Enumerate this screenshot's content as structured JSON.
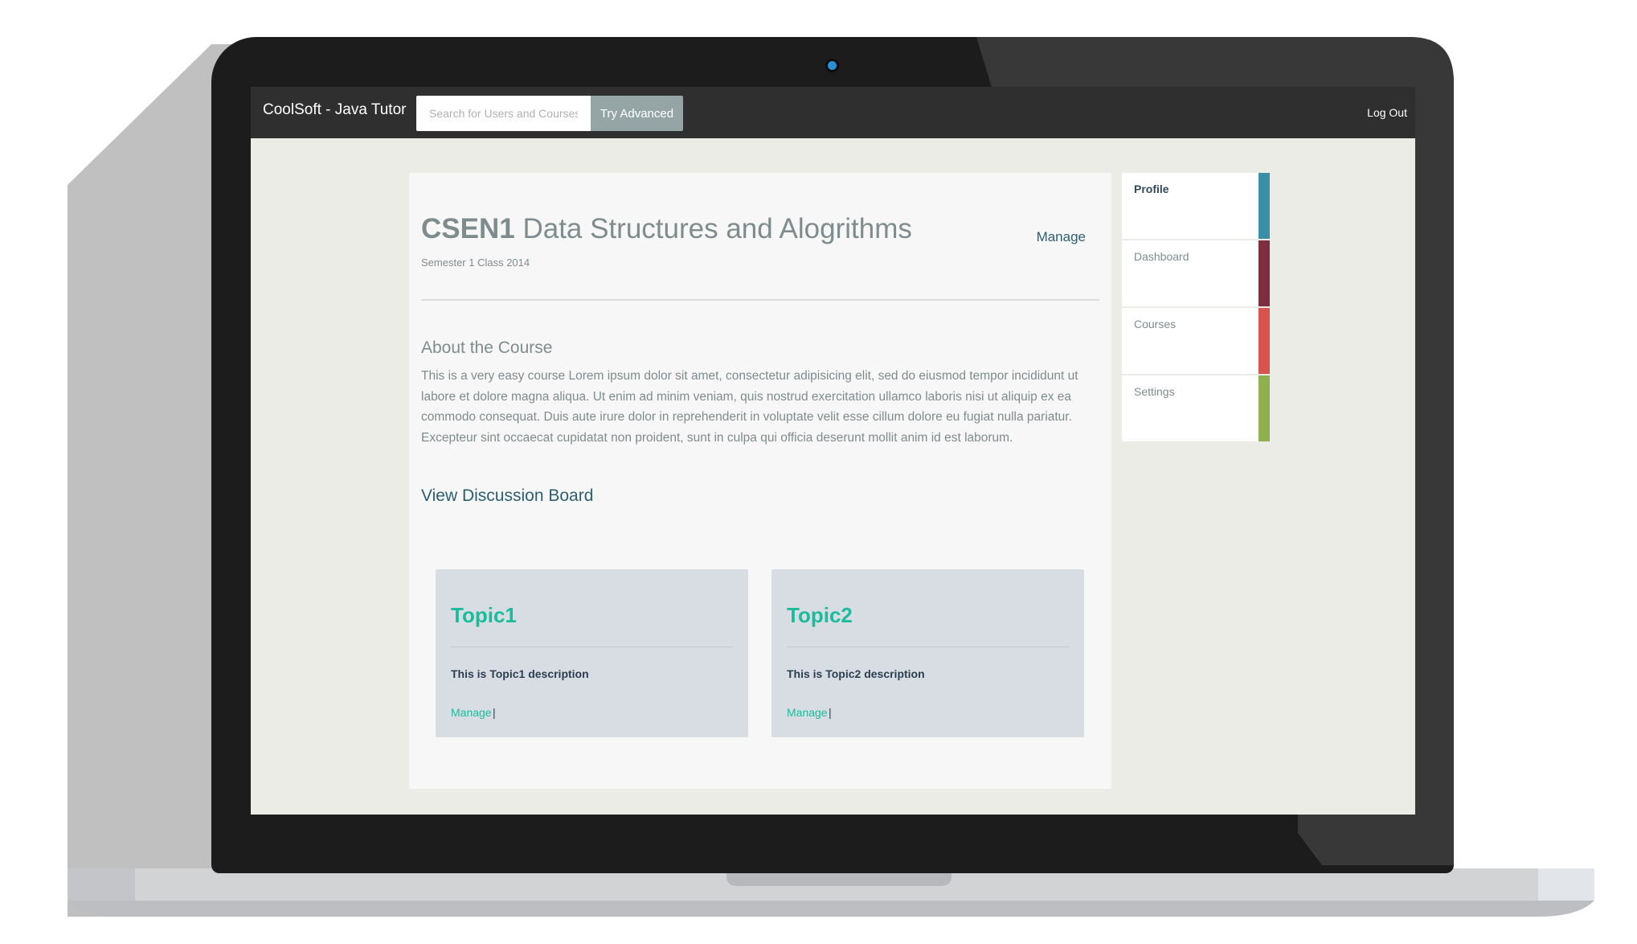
{
  "navbar": {
    "brand": "CoolSoft - Java Tutor",
    "search_placeholder": "Search for Users and Courses",
    "try_advanced_label": "Try Advanced",
    "logout_label": "Log Out"
  },
  "course": {
    "code": "CSEN1",
    "name": "Data Structures and Alogrithms",
    "subtitle": "Semester 1 Class 2014",
    "manage_label": "Manage",
    "about_heading": "About the Course",
    "about_text": "This is a very easy course Lorem ipsum dolor sit amet, consectetur adipisicing elit, sed do eiusmod tempor incididunt ut labore et dolore magna aliqua. Ut enim ad minim veniam, quis nostrud exercitation ullamco laboris nisi ut aliquip ex ea commodo consequat. Duis aute irure dolor in reprehenderit in voluptate velit esse cillum dolore eu fugiat nulla pariatur. Excepteur sint occaecat cupidatat non proident, sunt in culpa qui officia deserunt mollit anim id est laborum.",
    "discussion_label": "View Discussion Board"
  },
  "topics": [
    {
      "title": "Topic1",
      "description": "This is Topic1 description",
      "manage_label": "Manage",
      "separator": "|"
    },
    {
      "title": "Topic2",
      "description": "This is Topic2 description",
      "manage_label": "Manage",
      "separator": "|"
    }
  ],
  "side_menu": {
    "items": [
      {
        "label": "Profile",
        "color": "#3a8fa6",
        "active": true
      },
      {
        "label": "Dashboard",
        "color": "#7d2f3f",
        "active": false
      },
      {
        "label": "Courses",
        "color": "#d9534f",
        "active": false
      },
      {
        "label": "Settings",
        "color": "#8fb04f",
        "active": false
      }
    ]
  },
  "colors": {
    "navbar_bg": "#2f2f2f",
    "page_bg": "#ecece6",
    "accent_teal": "#1abc9c",
    "link_blue": "#2c5f73",
    "try_advanced_bg": "#95a5a6"
  }
}
